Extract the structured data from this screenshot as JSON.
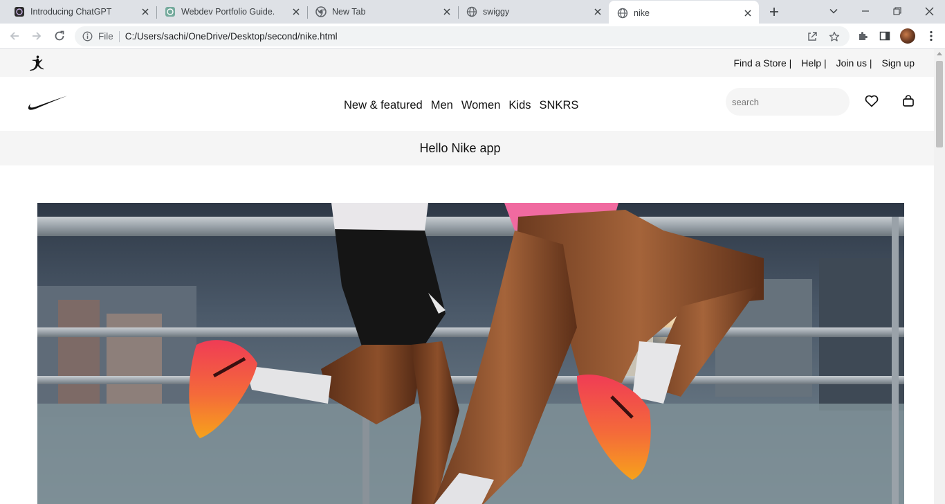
{
  "browser": {
    "tabs": [
      {
        "title": "Introducing ChatGPT",
        "icon": "chatgpt-icon",
        "active": false
      },
      {
        "title": "Webdev Portfolio Guide.",
        "icon": "openai-icon",
        "active": false
      },
      {
        "title": "New Tab",
        "icon": "chrome-icon",
        "active": false
      },
      {
        "title": "swiggy",
        "icon": "globe-icon",
        "active": false
      },
      {
        "title": "nike",
        "icon": "globe-icon",
        "active": true
      }
    ],
    "address": {
      "scheme": "File",
      "url": "C:/Users/sachi/OneDrive/Desktop/second/nike.html"
    }
  },
  "page": {
    "utility_nav": [
      "Find a Store |",
      "Help |",
      "Join us |",
      "Sign up"
    ],
    "main_nav": [
      "New & featured",
      "Men",
      "Women",
      "Kids",
      "SNKRS"
    ],
    "search": {
      "placeholder": "search",
      "value": ""
    },
    "promo_text": "Hello Nike app",
    "hero_image": "runners-legs-in-pink-and-orange-running-shoes"
  },
  "colors": {
    "tab_strip": "#dee1e6",
    "utility_bar": "#f5f5f5",
    "promo_bar": "#f5f5f5",
    "text": "#111111",
    "shoe_pink": "#f0415a",
    "shoe_orange": "#f7a21b"
  }
}
